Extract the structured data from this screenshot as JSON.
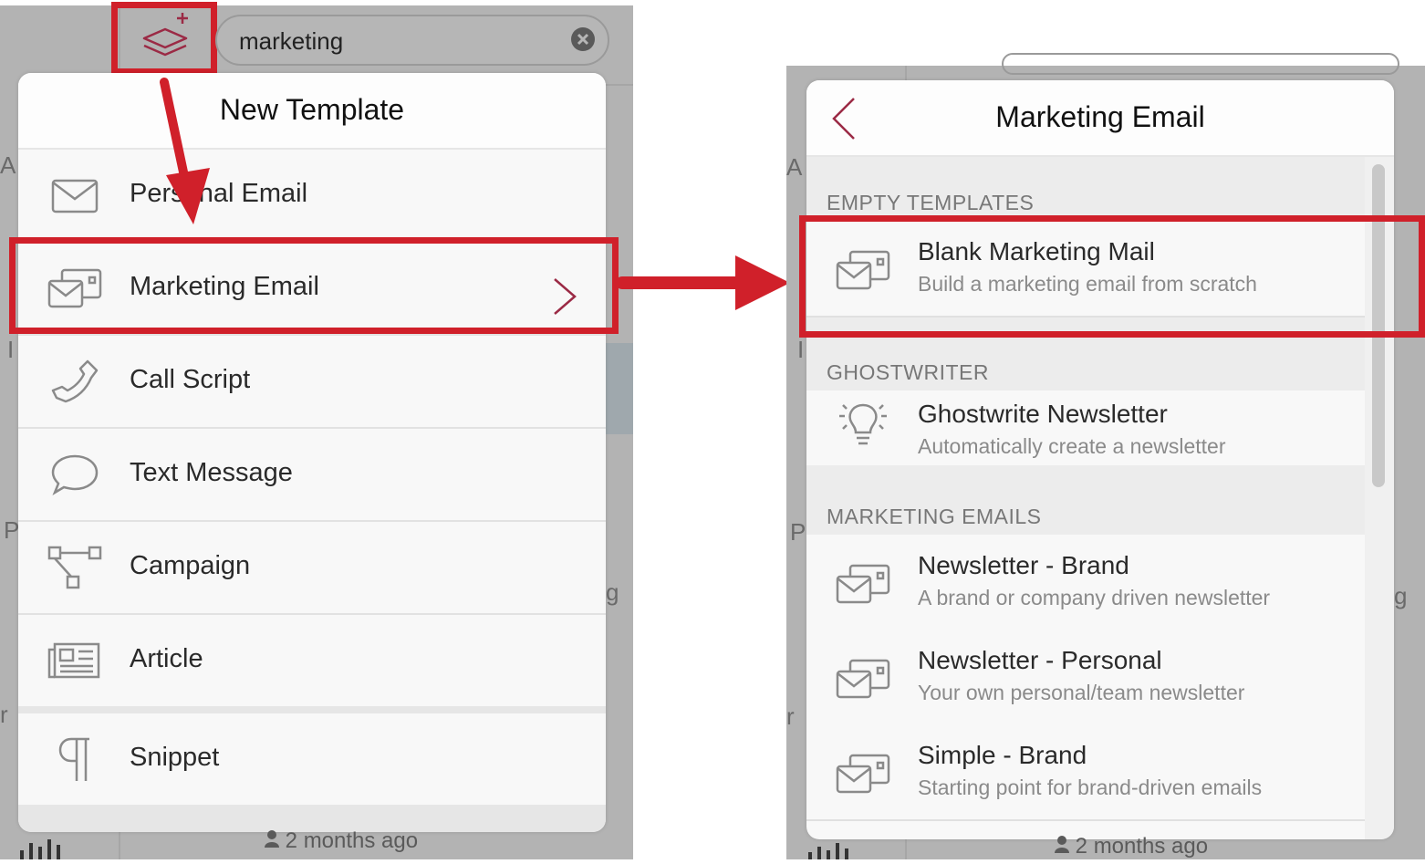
{
  "search": {
    "value": "marketing"
  },
  "left_popover": {
    "title": "New Template",
    "items": [
      {
        "label": "Personal Email",
        "icon": "envelope-icon"
      },
      {
        "label": "Marketing Email",
        "icon": "marketing-mail-icon"
      },
      {
        "label": "Call Script",
        "icon": "phone-icon"
      },
      {
        "label": "Text Message",
        "icon": "speech-bubble-icon"
      },
      {
        "label": "Campaign",
        "icon": "flow-diagram-icon"
      },
      {
        "label": "Article",
        "icon": "newspaper-icon"
      },
      {
        "label": "Snippet",
        "icon": "pilcrow-icon"
      }
    ]
  },
  "right_popover": {
    "title": "Marketing Email",
    "sections": [
      {
        "heading": "Empty Templates",
        "items": [
          {
            "title": "Blank Marketing Mail",
            "subtitle": "Build a marketing email from scratch",
            "icon": "marketing-mail-icon"
          }
        ]
      },
      {
        "heading": "Ghostwriter",
        "items": [
          {
            "title": "Ghostwrite Newsletter",
            "subtitle": "Automatically create a newsletter",
            "icon": "lightbulb-icon"
          }
        ]
      },
      {
        "heading": "Marketing Emails",
        "items": [
          {
            "title": "Newsletter - Brand",
            "subtitle": "A brand or company driven newsletter",
            "icon": "marketing-mail-icon"
          },
          {
            "title": "Newsletter - Personal",
            "subtitle": "Your own personal/team newsletter",
            "icon": "marketing-mail-icon"
          },
          {
            "title": "Simple - Brand",
            "subtitle": "Starting point for brand-driven emails",
            "icon": "marketing-mail-icon"
          }
        ]
      }
    ]
  },
  "background": {
    "timestamp_left": "2 months ago",
    "timestamp_right": "2 months ago"
  },
  "colors": {
    "accent": "#9b2a45",
    "highlight": "#d0202a"
  }
}
